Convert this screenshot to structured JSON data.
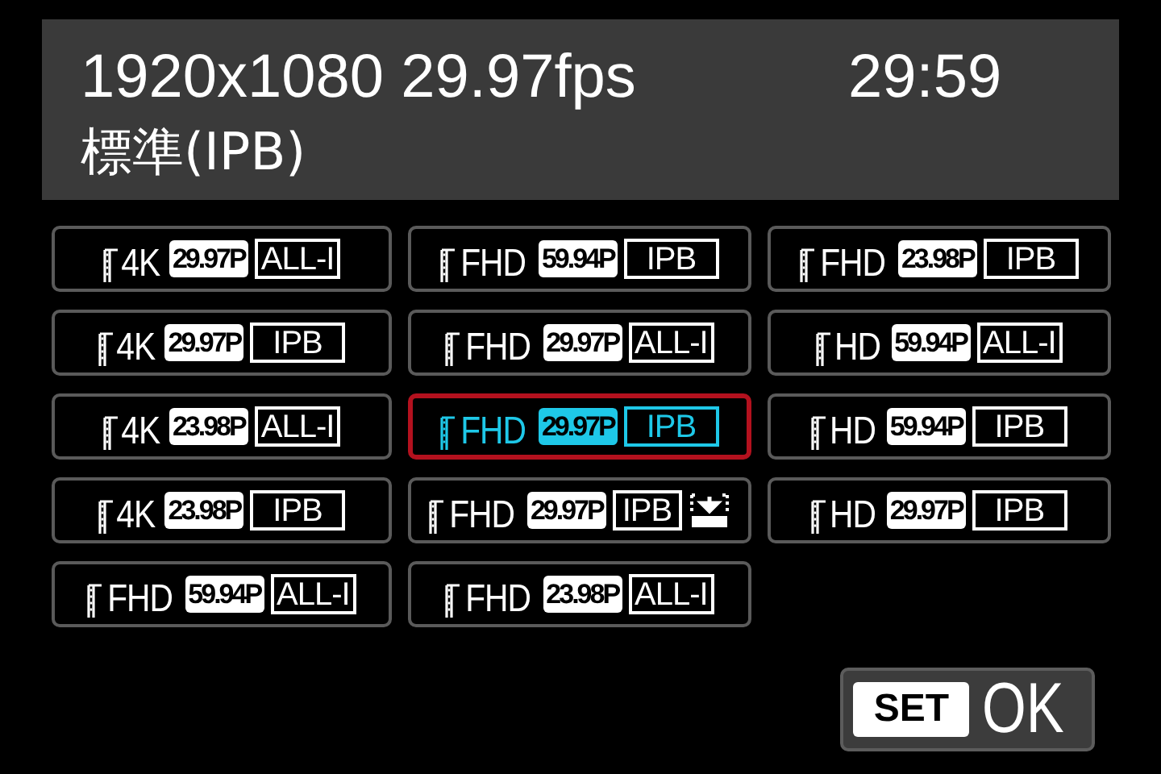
{
  "header": {
    "format": "1920x1080 29.97fps",
    "time": "29:59",
    "quality": "標準(IPB)"
  },
  "options": [
    {
      "resolution": "4K",
      "frame_rate": "29.97P",
      "compression": "ALL-I",
      "selected": false
    },
    {
      "resolution": "4K",
      "frame_rate": "29.97P",
      "compression": "IPB",
      "selected": false
    },
    {
      "resolution": "4K",
      "frame_rate": "23.98P",
      "compression": "ALL-I",
      "selected": false
    },
    {
      "resolution": "4K",
      "frame_rate": "23.98P",
      "compression": "IPB",
      "selected": false
    },
    {
      "resolution": "FHD",
      "frame_rate": "59.94P",
      "compression": "ALL-I",
      "selected": false
    },
    {
      "resolution": "FHD",
      "frame_rate": "59.94P",
      "compression": "IPB",
      "selected": false
    },
    {
      "resolution": "FHD",
      "frame_rate": "29.97P",
      "compression": "ALL-I",
      "selected": false
    },
    {
      "resolution": "FHD",
      "frame_rate": "29.97P",
      "compression": "IPB",
      "selected": true
    },
    {
      "resolution": "FHD",
      "frame_rate": "29.97P",
      "compression": "IPB",
      "kind": "light",
      "selected": false
    },
    {
      "resolution": "FHD",
      "frame_rate": "23.98P",
      "compression": "ALL-I",
      "selected": false
    },
    {
      "resolution": "FHD",
      "frame_rate": "23.98P",
      "compression": "IPB",
      "selected": false
    },
    {
      "resolution": "HD",
      "frame_rate": "59.94P",
      "compression": "ALL-I",
      "selected": false
    },
    {
      "resolution": "HD",
      "frame_rate": "59.94P",
      "compression": "IPB",
      "selected": false
    },
    {
      "resolution": "HD",
      "frame_rate": "29.97P",
      "compression": "IPB",
      "selected": false
    }
  ],
  "set_button": {
    "key": "SET",
    "label": "OK"
  }
}
